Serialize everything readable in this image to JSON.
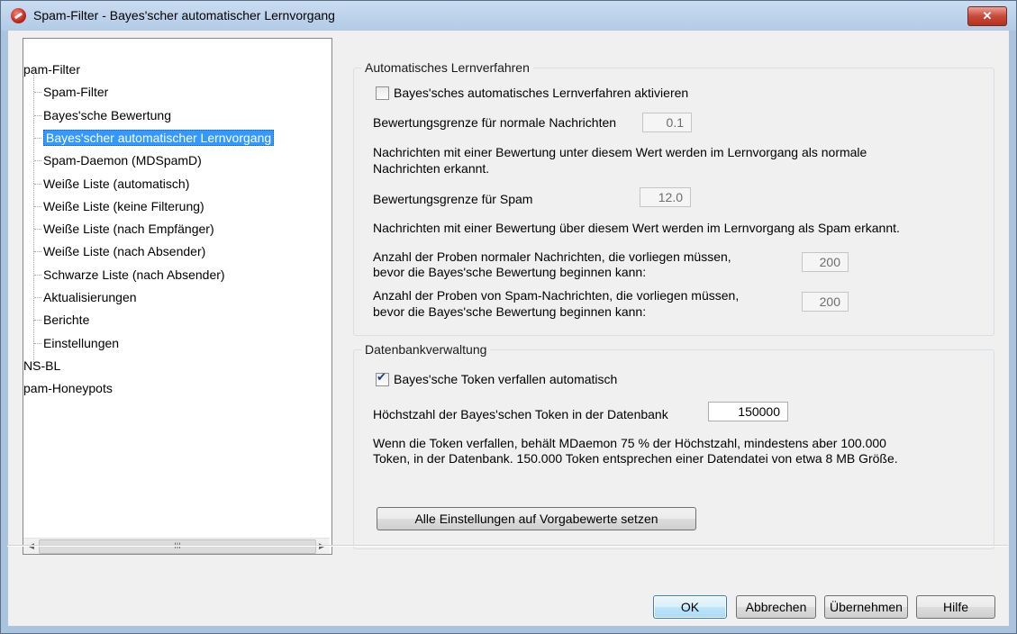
{
  "window": {
    "title": "Spam-Filter - Bayes'scher automatischer Lernvorgang",
    "close_label": "✕"
  },
  "tree": {
    "items": [
      {
        "label": "pam-Filter",
        "level": 0
      },
      {
        "label": "Spam-Filter",
        "level": 1
      },
      {
        "label": "Bayes'sche Bewertung",
        "level": 1
      },
      {
        "label": "Bayes'scher automatischer Lernvorgang",
        "level": 1,
        "selected": true
      },
      {
        "label": "Spam-Daemon (MDSpamD)",
        "level": 1
      },
      {
        "label": "Weiße Liste (automatisch)",
        "level": 1
      },
      {
        "label": "Weiße Liste (keine Filterung)",
        "level": 1
      },
      {
        "label": "Weiße Liste (nach Empfänger)",
        "level": 1
      },
      {
        "label": "Weiße Liste (nach Absender)",
        "level": 1
      },
      {
        "label": "Schwarze Liste (nach Absender)",
        "level": 1
      },
      {
        "label": "Aktualisierungen",
        "level": 1
      },
      {
        "label": "Berichte",
        "level": 1
      },
      {
        "label": "Einstellungen",
        "level": 1
      },
      {
        "label": "NS-BL",
        "level": 0
      },
      {
        "label": "pam-Honeypots",
        "level": 0
      }
    ],
    "scroll_left": "◀",
    "scroll_right": "▶",
    "scroll_grip": "III"
  },
  "learning": {
    "group_title": "Automatisches Lernverfahren",
    "enable_label": "Bayes'sches automatisches Lernverfahren aktivieren",
    "enable_checked": false,
    "normal_threshold_label": "Bewertungsgrenze für normale Nachrichten",
    "normal_threshold_value": "0.1",
    "normal_desc_line1": "Nachrichten mit einer Bewertung unter diesem Wert werden im Lernvorgang als normale",
    "normal_desc_line2": "Nachrichten erkannt.",
    "spam_threshold_label": "Bewertungsgrenze für Spam",
    "spam_threshold_value": "12.0",
    "spam_desc": "Nachrichten mit einer Bewertung über diesem Wert werden im Lernvorgang als Spam erkannt.",
    "normal_samples_line1": "Anzahl der Proben normaler Nachrichten, die vorliegen müssen,",
    "normal_samples_line2": "bevor die Bayes'sche Bewertung beginnen kann:",
    "normal_samples_value": "200",
    "spam_samples_line1": "Anzahl der Proben von Spam-Nachrichten, die vorliegen müssen,",
    "spam_samples_line2": "bevor die Bayes'sche Bewertung beginnen kann:",
    "spam_samples_value": "200"
  },
  "database": {
    "group_title": "Datenbankverwaltung",
    "expire_label": "Bayes'sche Token verfallen automatisch",
    "expire_checked": true,
    "max_tokens_label": "Höchstzahl der Bayes'schen Token in der Datenbank",
    "max_tokens_value": "150000",
    "desc_line1": "Wenn die Token verfallen, behält MDaemon 75 % der Höchstzahl, mindestens aber 100.000",
    "desc_line2": "Token, in der Datenbank. 150.000 Token entsprechen einer Datendatei von etwa 8 MB Größe.",
    "reset_button": "Alle Einstellungen auf Vorgabewerte setzen"
  },
  "buttons": {
    "ok": "OK",
    "cancel": "Abbrechen",
    "apply": "Übernehmen",
    "help": "Hilfe"
  }
}
